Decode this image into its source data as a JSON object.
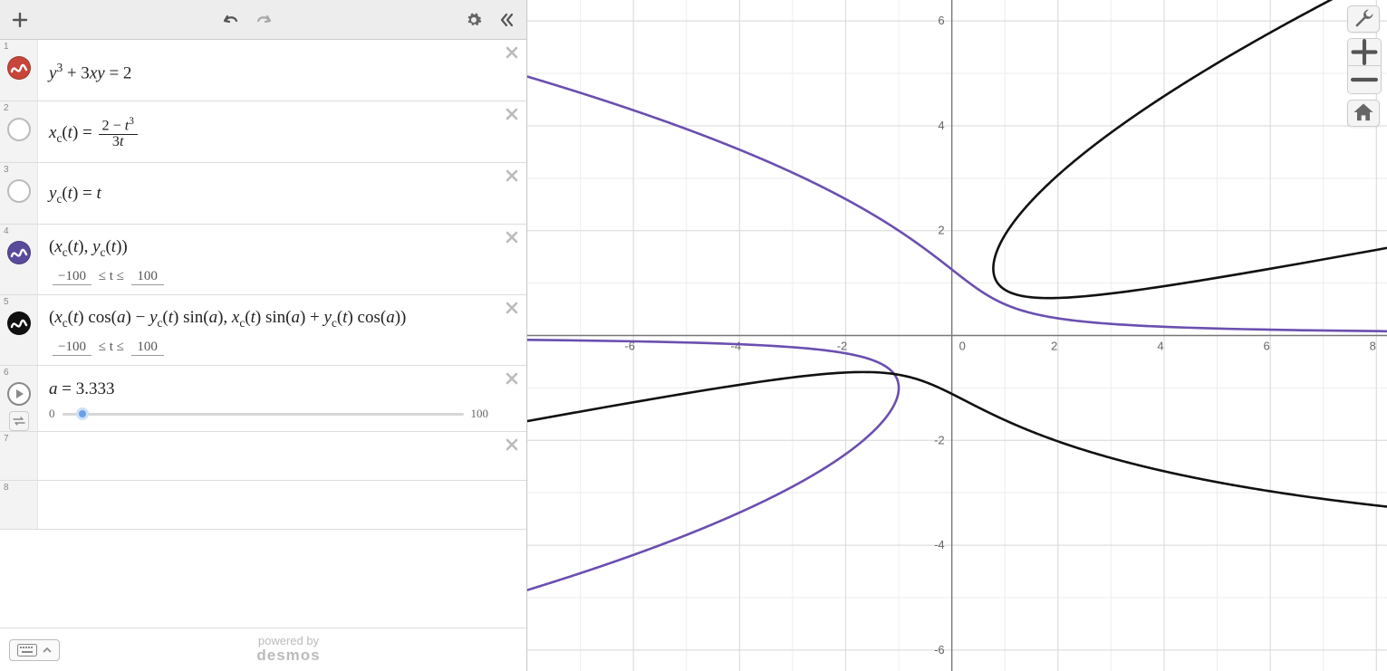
{
  "toolbar": {
    "add_tooltip": "Add item"
  },
  "expressions": [
    {
      "index": "1",
      "latex_html": "<i>y</i><span class='sup'>3</span> + 3<i>xy</i> = 2",
      "has_icon": true,
      "icon_color": "#c7453a",
      "icon_type": "wave",
      "delete": true
    },
    {
      "index": "2",
      "latex_html": "<i>x</i><span class='sub'>c</span>(<i>t</i>) = <span class='frac'><span class='num'>2 − <i>t</i><span class='sup'>3</span></span><span class='den'>3<i>t</i></span></span>",
      "has_icon": true,
      "icon_empty": true,
      "delete": true
    },
    {
      "index": "3",
      "latex_html": "<i>y</i><span class='sub'>c</span>(<i>t</i>) = <i>t</i>",
      "has_icon": true,
      "icon_empty": true,
      "delete": true
    },
    {
      "index": "4",
      "latex_html": "(<i>x</i><span class='sub'>c</span>(<i>t</i>), <i>y</i><span class='sub'>c</span>(<i>t</i>))",
      "has_icon": true,
      "icon_color": "#5a4a9c",
      "icon_type": "wave",
      "delete": true,
      "domain": {
        "min": "−100",
        "max": "100"
      }
    },
    {
      "index": "5",
      "latex_html": "(<i>x</i><span class='sub'>c</span>(<i>t</i>) cos(<i>a</i>) − <i>y</i><span class='sub'>c</span>(<i>t</i>) sin(<i>a</i>), <i>x</i><span class='sub'>c</span>(<i>t</i>) sin(<i>a</i>) + <i>y</i><span class='sub'>c</span>(<i>t</i>) cos(<i>a</i>))",
      "has_icon": true,
      "icon_color": "#111",
      "icon_type": "wave",
      "delete": true,
      "domain": {
        "min": "−100",
        "max": "100"
      }
    },
    {
      "index": "6",
      "latex_html": "<i>a</i> = 3.333",
      "has_icon": true,
      "icon_play": true,
      "delete": true,
      "slider": {
        "min": "0",
        "max": "100",
        "pos_percent": 5
      }
    },
    {
      "index": "7",
      "latex_html": "",
      "has_icon": false,
      "delete": true
    },
    {
      "index": "8",
      "latex_html": "",
      "has_icon": false,
      "delete": false
    }
  ],
  "domain_text": {
    "le_t_le": "≤ t ≤"
  },
  "footer": {
    "powered_by": "powered by",
    "brand": "desmos"
  },
  "chart_data": {
    "type": "line",
    "title": "",
    "xlabel": "",
    "ylabel": "",
    "xlim": [
      -8,
      8.2
    ],
    "ylim": [
      -6.4,
      6.4
    ],
    "xticks": [
      -6,
      -4,
      -2,
      0,
      2,
      4,
      6,
      8
    ],
    "yticks": [
      -6,
      -4,
      -2,
      2,
      4,
      6
    ],
    "minor_grid": true,
    "series": [
      {
        "name": "y^3 + 3xy = 2 (implicit)",
        "color": "#c7453a",
        "implicit": "y^3 + 3*x*y = 2"
      },
      {
        "name": "(x_c(t), y_c(t))  with x_c=(2-t^3)/(3t), y_c=t",
        "color": "#6a4fb0",
        "parametric": true,
        "t_range": [
          -100,
          100
        ]
      },
      {
        "name": "rotated parametric by angle a",
        "color": "#111111",
        "parametric": true,
        "t_range": [
          -100,
          100
        ],
        "angle_a": 3.333
      }
    ]
  }
}
